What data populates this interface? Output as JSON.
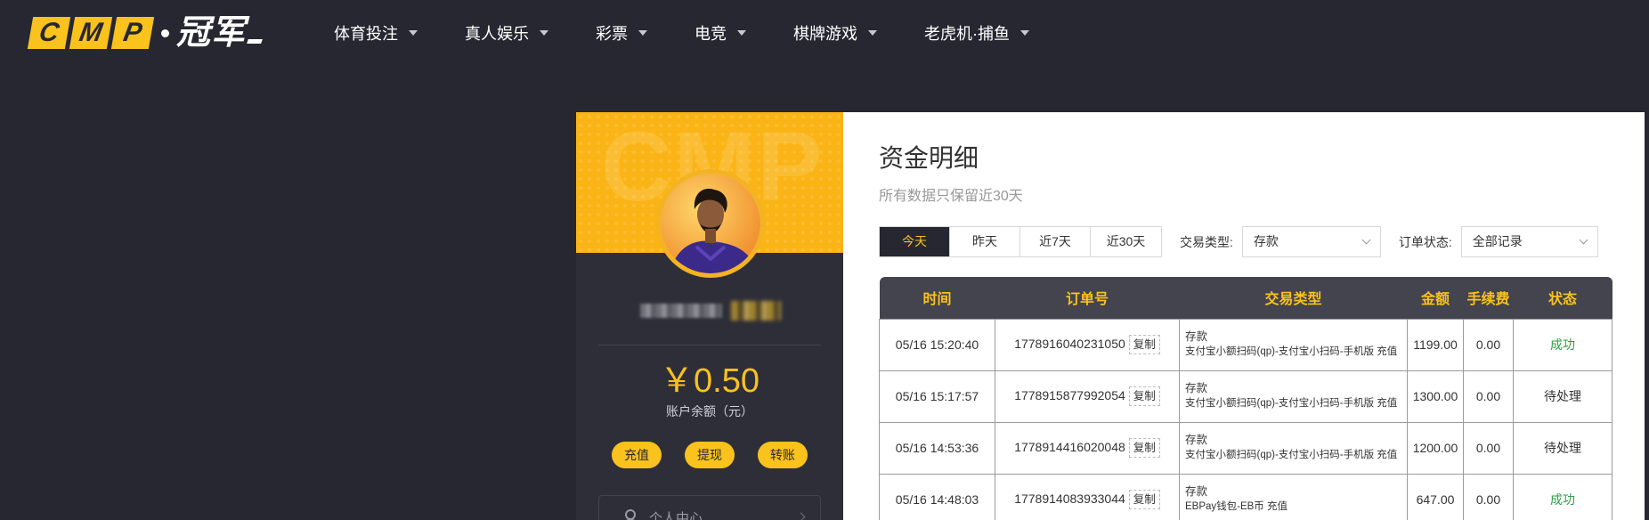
{
  "header": {
    "logo_letters": [
      "C",
      "M",
      "P"
    ],
    "logo_text": "冠军",
    "nav": [
      {
        "label": "体育投注"
      },
      {
        "label": "真人娱乐"
      },
      {
        "label": "彩票"
      },
      {
        "label": "电竞"
      },
      {
        "label": "棋牌游戏"
      },
      {
        "label": "老虎机·捕鱼"
      }
    ]
  },
  "profile": {
    "banner_watermark": "CMP",
    "balance": "￥0.50",
    "balance_label": "账户余额（元）",
    "actions": [
      "充值",
      "提现",
      "转账"
    ],
    "menu": [
      {
        "label": "个人中心",
        "icon": "user-icon"
      }
    ]
  },
  "main": {
    "title": "资金明细",
    "subtitle": "所有数据只保留近30天",
    "tabs": [
      {
        "label": "今天",
        "active": true
      },
      {
        "label": "昨天"
      },
      {
        "label": "近7天"
      },
      {
        "label": "近30天"
      }
    ],
    "filters": {
      "type_label": "交易类型:",
      "type_value": "存款",
      "status_label": "订单状态:",
      "status_value": "全部记录"
    },
    "table": {
      "headers": [
        "时间",
        "订单号",
        "交易类型",
        "金额",
        "手续费",
        "状态"
      ],
      "copy_label": "复制",
      "rows": [
        {
          "time": "05/16 15:20:40",
          "order": "1778916040231050",
          "type": "存款",
          "detail": "支付宝小额扫码(qp)-支付宝小扫码-手机版 充值",
          "amount": "1199.00",
          "fee": "0.00",
          "status": "成功",
          "ok": true
        },
        {
          "time": "05/16 15:17:57",
          "order": "1778915877992054",
          "type": "存款",
          "detail": "支付宝小额扫码(qp)-支付宝小扫码-手机版 充值",
          "amount": "1300.00",
          "fee": "0.00",
          "status": "待处理",
          "ok": false
        },
        {
          "time": "05/16 14:53:36",
          "order": "1778914416020048",
          "type": "存款",
          "detail": "支付宝小额扫码(qp)-支付宝小扫码-手机版 充值",
          "amount": "1200.00",
          "fee": "0.00",
          "status": "待处理",
          "ok": false
        },
        {
          "time": "05/16 14:48:03",
          "order": "1778914083933044",
          "type": "存款",
          "detail": "EBPay钱包-EB币 充值",
          "amount": "647.00",
          "fee": "0.00",
          "status": "成功",
          "ok": true
        }
      ]
    }
  },
  "colors": {
    "bg": "#272731",
    "accent": "#f9c21c",
    "header_row": "#44444e",
    "success": "#2ea043"
  }
}
